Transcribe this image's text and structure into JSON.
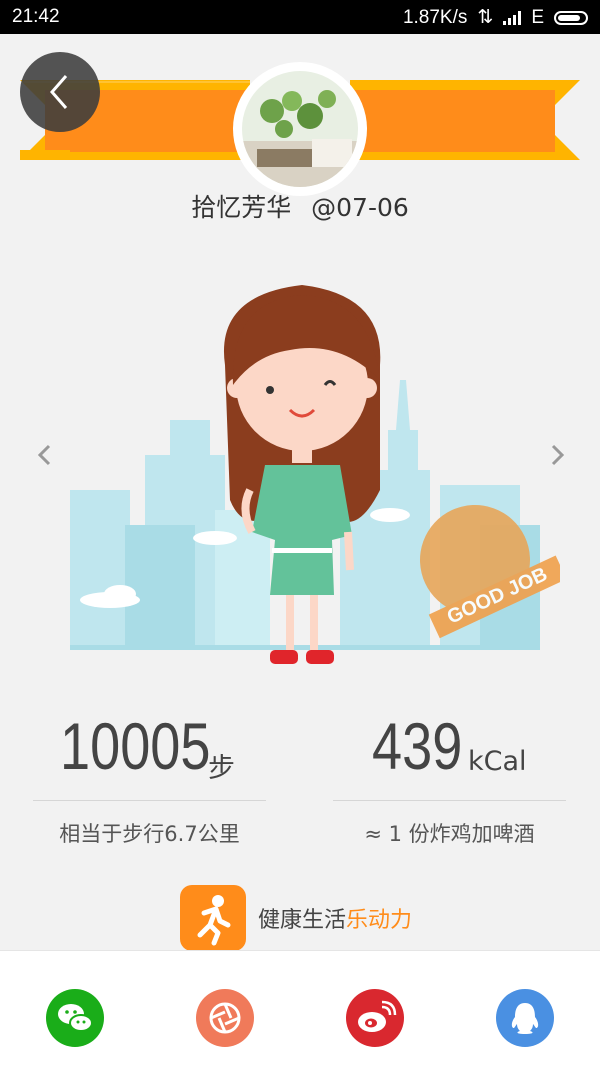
{
  "status_bar": {
    "time": "21:42",
    "speed": "1.87K/s",
    "network": "E"
  },
  "profile": {
    "name": "拾忆芳华",
    "date": "@07-06"
  },
  "stamp": {
    "text": "GOOD JOB"
  },
  "stats": {
    "steps": {
      "value": "10005",
      "unit": "步",
      "note": "相当于步行6.7公里"
    },
    "calories": {
      "value": "439",
      "unit": "kCal",
      "note": "≈ 1 份炸鸡加啤酒"
    }
  },
  "promo": {
    "prefix": "健康生活",
    "highlight": "乐动力"
  },
  "share": {
    "icons": [
      "wechat-icon",
      "moments-icon",
      "weibo-icon",
      "qq-icon"
    ]
  },
  "colors": {
    "accent": "#ff8c1a",
    "banner_yellow": "#ffb400",
    "wechat": "#1aad19",
    "moments": "#f07a5a",
    "weibo": "#d9282f",
    "qq": "#4a90e2"
  }
}
